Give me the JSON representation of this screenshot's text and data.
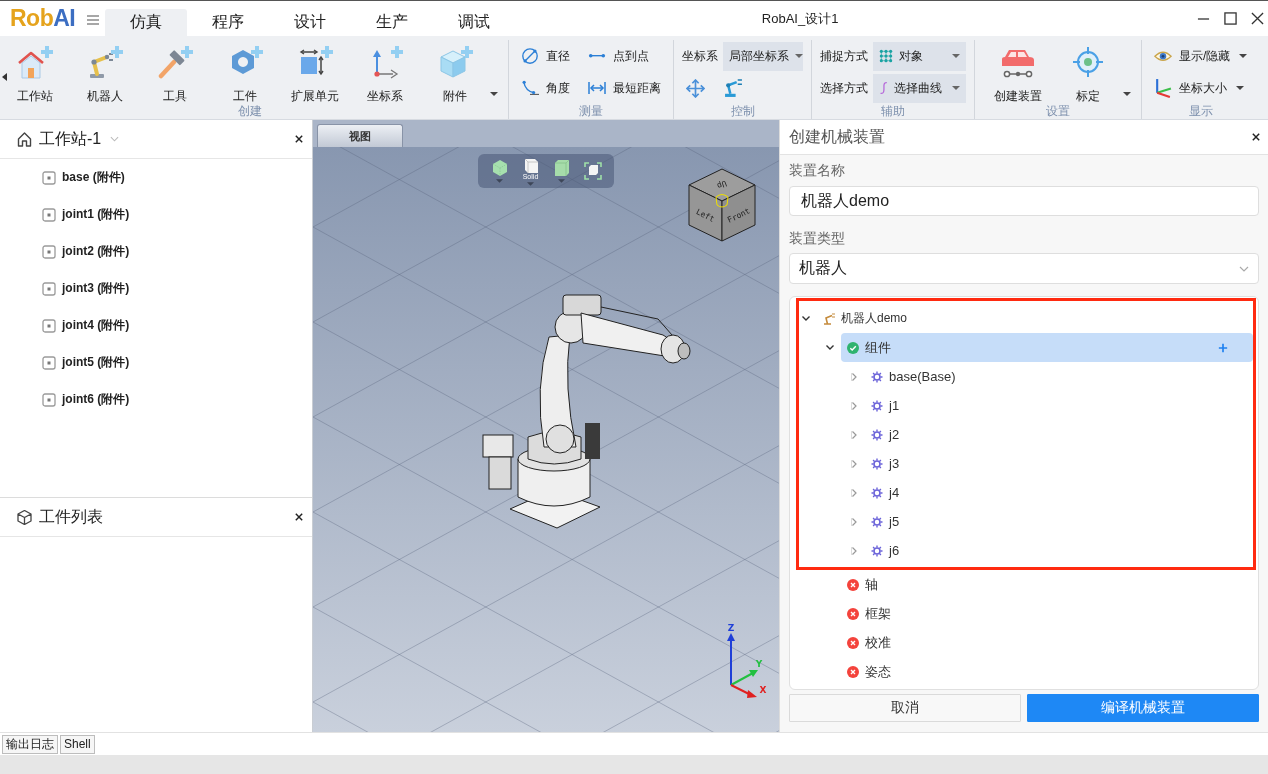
{
  "title_bar": {
    "logo_primary": "Rob",
    "logo_accent": "AI",
    "title": "RobAI_设计1"
  },
  "menu_tabs": [
    {
      "label": "仿真",
      "selected": true
    },
    {
      "label": "程序",
      "selected": false
    },
    {
      "label": "设计",
      "selected": false
    },
    {
      "label": "生产",
      "selected": false
    },
    {
      "label": "调试",
      "selected": false
    }
  ],
  "ribbon": [
    {
      "kind": "large",
      "label": "创建",
      "items": [
        {
          "label": "工作站",
          "dropdown": false
        },
        {
          "label": "机器人",
          "dropdown": false
        },
        {
          "label": "工具",
          "dropdown": false
        },
        {
          "label": "工件",
          "dropdown": false
        },
        {
          "label": "扩展单元",
          "dropdown": false
        },
        {
          "label": "坐标系",
          "dropdown": false
        },
        {
          "label": "附件",
          "dropdown": true
        }
      ]
    },
    {
      "kind": "small",
      "label": "测量",
      "items": [
        {
          "label": "直径",
          "dropdown": false
        },
        {
          "label": "点到点",
          "dropdown": false
        },
        {
          "label": "角度",
          "dropdown": false
        },
        {
          "label": "最短距离",
          "dropdown": false
        }
      ]
    },
    {
      "kind": "control",
      "label": "控制",
      "fields": [
        {
          "label": "坐标系",
          "value": "局部坐标系"
        }
      ]
    },
    {
      "kind": "combos",
      "label": "辅助",
      "fields": [
        {
          "label": "捕捉方式",
          "value": "对象"
        },
        {
          "label": "选择方式",
          "value": "选择曲线"
        }
      ]
    },
    {
      "kind": "large",
      "label": "设置",
      "items": [
        {
          "label": "创建装置",
          "dropdown": false
        },
        {
          "label": "标定",
          "dropdown": true
        }
      ]
    },
    {
      "kind": "small",
      "label": "显示",
      "items": [
        {
          "label": "显示/隐藏",
          "dropdown": true
        },
        {
          "label": "坐标大小",
          "dropdown": true
        }
      ]
    }
  ],
  "workstation_panel": {
    "title": "工作站-1",
    "items": [
      "base (附件)",
      "joint1 (附件)",
      "joint2 (附件)",
      "joint3 (附件)",
      "joint4 (附件)",
      "joint5 (附件)",
      "joint6 (附件)"
    ]
  },
  "parts_panel": {
    "title": "工件列表"
  },
  "viewport": {
    "tab": "视图",
    "display_mode": "Solid",
    "view_cube": {
      "top": "Up",
      "left": "Left",
      "right": "Front"
    },
    "axes": {
      "z": "Z",
      "y": "Y",
      "x": "X"
    }
  },
  "device_panel": {
    "title": "创建机械装置",
    "name_label": "装置名称",
    "name_value": "机器人demo",
    "type_label": "装置类型",
    "type_value": "机器人",
    "highlight_frame": true,
    "tree": [
      {
        "label": "机器人demo",
        "kind": "robot",
        "expanded": true,
        "selected": false,
        "children": [
          {
            "label": "组件",
            "kind": "status",
            "complete": true,
            "expanded": true,
            "selected": true,
            "children": [
              {
                "label": "base(Base)",
                "kind": "joint",
                "expanded": false,
                "selected": false
              },
              {
                "label": "j1",
                "kind": "joint",
                "expanded": false,
                "selected": false
              },
              {
                "label": "j2",
                "kind": "joint",
                "expanded": false,
                "selected": false
              },
              {
                "label": "j3",
                "kind": "joint",
                "expanded": false,
                "selected": false
              },
              {
                "label": "j4",
                "kind": "joint",
                "expanded": false,
                "selected": false
              },
              {
                "label": "j5",
                "kind": "joint",
                "expanded": false,
                "selected": false
              },
              {
                "label": "j6",
                "kind": "joint",
                "expanded": false,
                "selected": false
              }
            ]
          },
          {
            "label": "轴",
            "kind": "status",
            "complete": false,
            "selected": false
          },
          {
            "label": "框架",
            "kind": "status",
            "complete": false,
            "selected": false
          },
          {
            "label": "校准",
            "kind": "status",
            "complete": false,
            "selected": false
          },
          {
            "label": "姿态",
            "kind": "status",
            "complete": false,
            "selected": false
          }
        ]
      }
    ],
    "buttons": [
      {
        "label": "取消",
        "kind": "secondary"
      },
      {
        "label": "编译机械装置",
        "kind": "primary"
      }
    ]
  },
  "bottom_tabs": [
    "输出日志",
    "Shell"
  ]
}
